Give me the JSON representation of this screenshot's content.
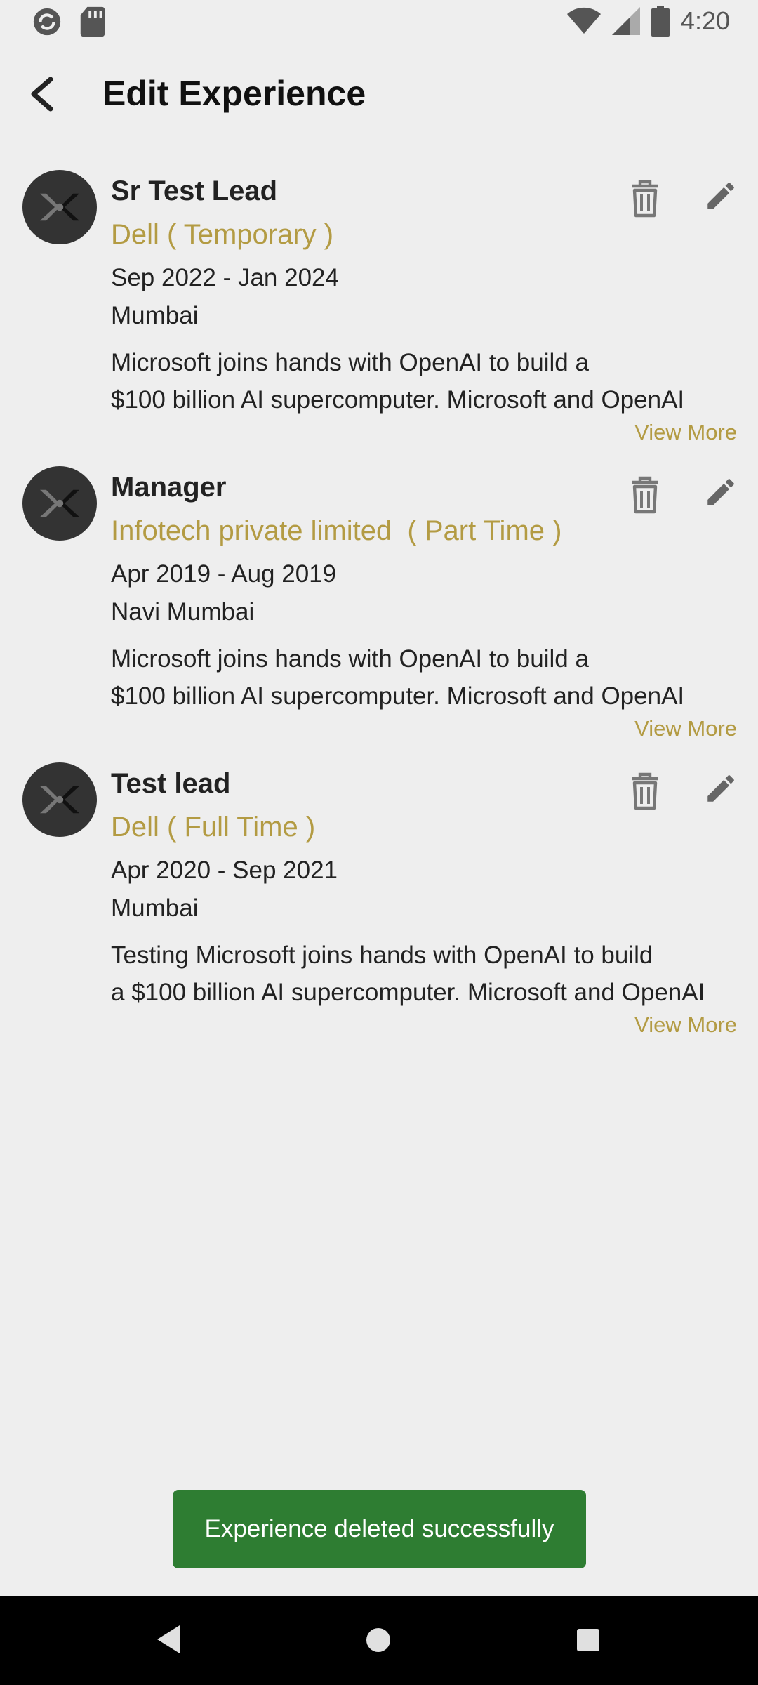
{
  "status_bar": {
    "time": "4:20",
    "icons": [
      "sync-icon",
      "sd-card-icon",
      "wifi-icon",
      "signal-icon",
      "battery-icon"
    ]
  },
  "app_bar": {
    "title": "Edit Experience",
    "back_icon": "back-arrow-icon"
  },
  "experiences": [
    {
      "title": "Sr Test Lead",
      "company": "Dell ( Temporary )",
      "dates": "Sep 2022 - Jan 2024",
      "location": "Mumbai",
      "desc_line1": "Microsoft joins hands with OpenAI to build a",
      "desc_line2": "$100 billion AI supercomputer. Microsoft and OpenAI",
      "view_more": "View More"
    },
    {
      "title": "Manager",
      "company": "Infotech private limited  ( Part Time )",
      "dates": "Apr 2019 - Aug 2019",
      "location": "Navi Mumbai",
      "desc_line1": "Microsoft joins hands with OpenAI to build a",
      "desc_line2": "$100 billion AI supercomputer. Microsoft and OpenAI",
      "view_more": "View More"
    },
    {
      "title": "Test lead",
      "company": "Dell ( Full Time )",
      "dates": "Apr 2020 - Sep 2021",
      "location": "Mumbai",
      "desc_line1": "Testing Microsoft joins hands with OpenAI to build",
      "desc_line2": "a $100 billion AI supercomputer. Microsoft and OpenAI",
      "view_more": "View More"
    }
  ],
  "toast": {
    "message": "Experience deleted successfully"
  },
  "colors": {
    "accent": "#b39b43",
    "toast_bg": "#2e7d32",
    "background": "#eeeeee"
  }
}
